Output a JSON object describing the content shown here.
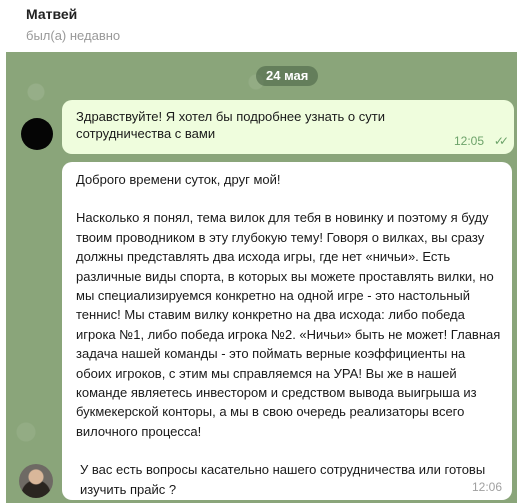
{
  "contact": {
    "name": "Матвей",
    "status": "был(а) недавно"
  },
  "chat": {
    "date_label": "24 мая",
    "messages": [
      {
        "direction": "outgoing",
        "text": "Здравствуйте! Я хотел бы подробнее узнать о сути сотрудничества с вами",
        "time": "12:05",
        "read": true
      },
      {
        "direction": "incoming",
        "paragraphs": [
          "Доброго времени суток, друг мой!",
          "Насколько я понял, тема вилок для тебя в новинку и поэтому я буду твоим проводником в эту глубокую тему! Говоря о вилках, вы сразу должны представлять два исхода игры, где нет «ничьи». Есть различные виды спорта, в которых вы можете проставлять вилки, но мы специализируемся конкретно на одной игре - это настольный теннис! Мы ставим вилку конкретно на два исхода: либо победа игрока №1, либо победа игрока №2. «Ничьи» быть не может! Главная задача нашей команды - это поймать верные коэффициенты на обоих игроков, с этим мы справляемся на УРА! Вы же в нашей команде являетесь инвестором и средством вывода выигрыша из букмекерской конторы, а мы в свою очередь реализаторы всего вилочного процесса!",
          "У вас есть вопросы касательно нашего сотрудничества или готовы изучить прайс ?"
        ],
        "time": "12:06"
      }
    ]
  },
  "colors": {
    "chat_background": "#8aa57a",
    "outgoing_bubble": "#effddd",
    "incoming_bubble": "#ffffff",
    "read_ticks": "#6da36a"
  },
  "icons": {
    "read_receipt": "double-check-icon"
  }
}
